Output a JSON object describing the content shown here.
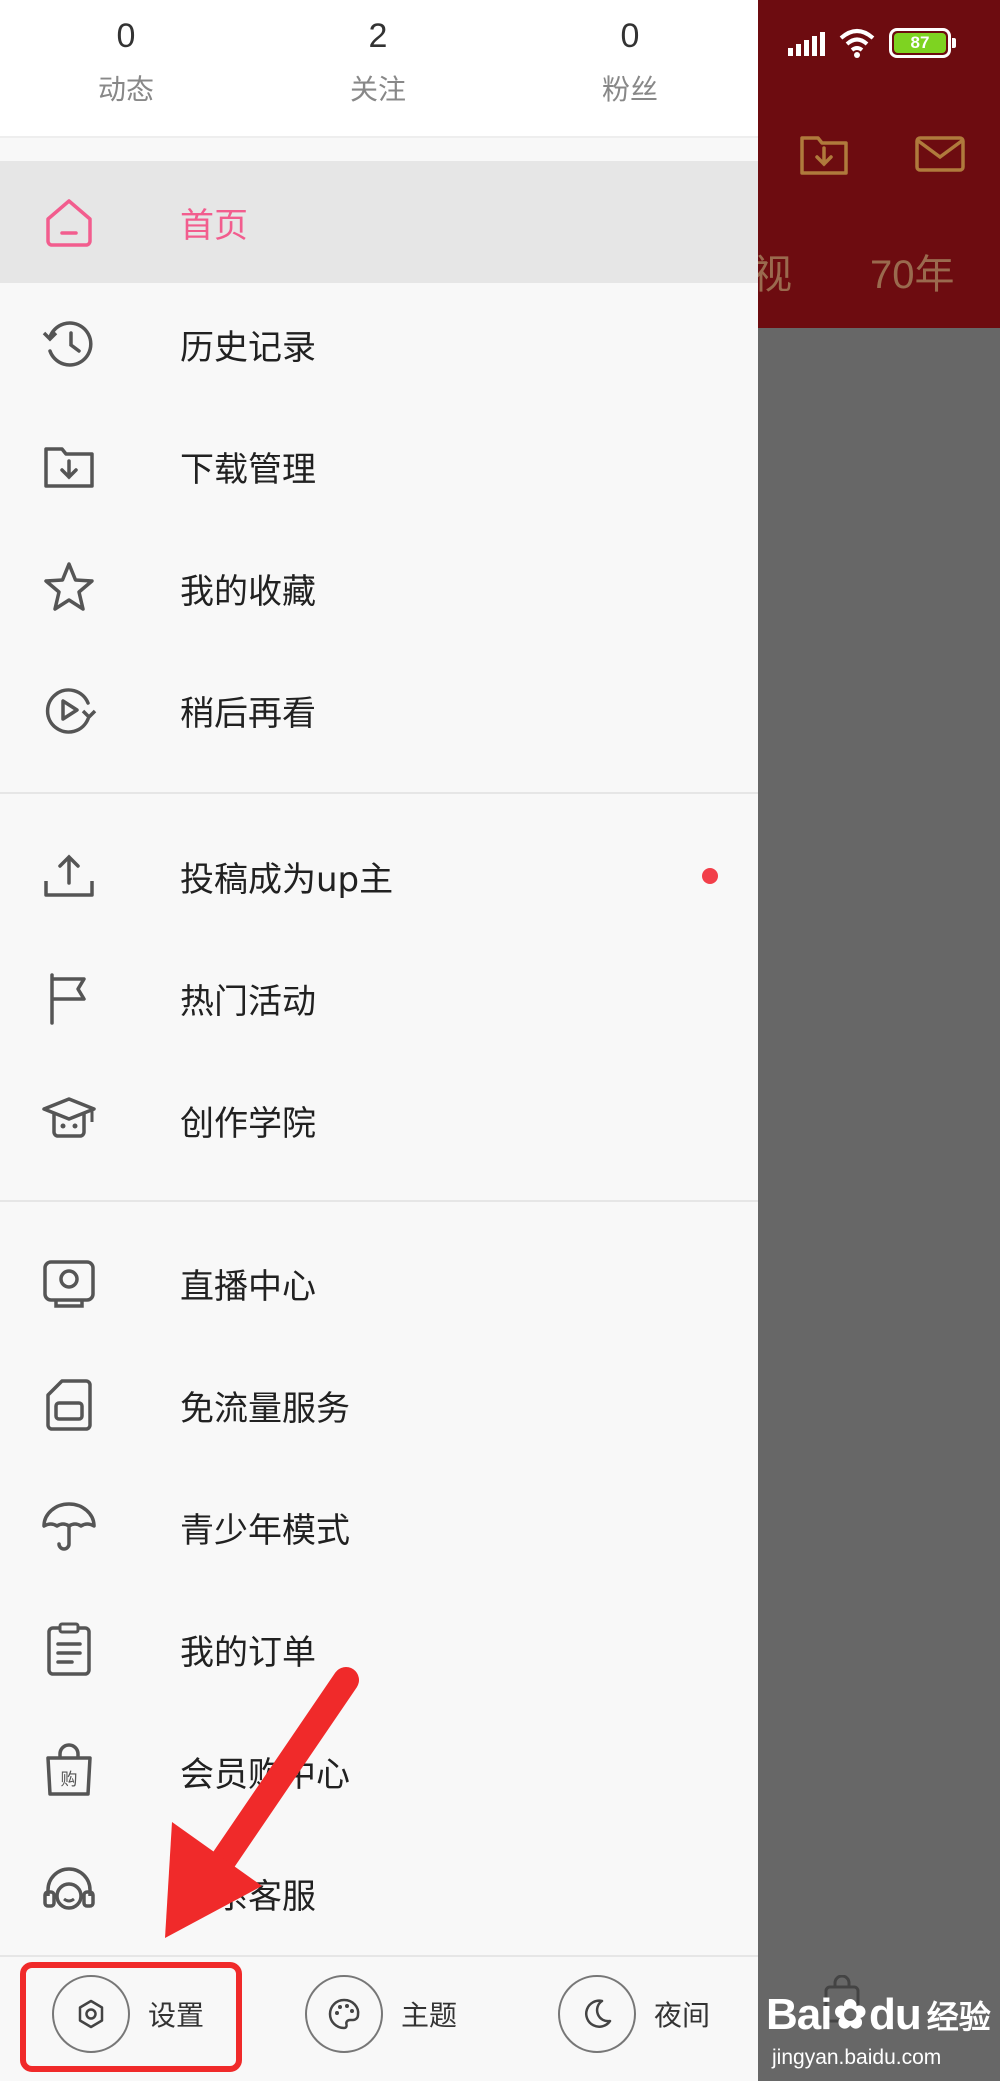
{
  "stats": [
    {
      "count": "0",
      "label": "动态"
    },
    {
      "count": "2",
      "label": "关注"
    },
    {
      "count": "0",
      "label": "粉丝"
    }
  ],
  "menu_group_1": [
    {
      "label": "首页",
      "icon": "home-icon",
      "active": true
    },
    {
      "label": "历史记录",
      "icon": "history-icon"
    },
    {
      "label": "下载管理",
      "icon": "download-folder-icon"
    },
    {
      "label": "我的收藏",
      "icon": "star-icon"
    },
    {
      "label": "稍后再看",
      "icon": "watch-later-icon"
    }
  ],
  "menu_group_2": [
    {
      "label": "投稿成为up主",
      "icon": "upload-icon",
      "badge": "red-dot"
    },
    {
      "label": "热门活动",
      "icon": "flag-icon"
    },
    {
      "label": "创作学院",
      "icon": "graduation-cap-icon"
    }
  ],
  "menu_group_3": [
    {
      "label": "直播中心",
      "icon": "live-tv-icon"
    },
    {
      "label": "免流量服务",
      "icon": "sim-card-icon"
    },
    {
      "label": "青少年模式",
      "icon": "umbrella-icon"
    },
    {
      "label": "我的订单",
      "icon": "clipboard-icon"
    },
    {
      "label": "会员购中心",
      "icon": "shopping-bag-icon"
    },
    {
      "label": "联系客服",
      "icon": "headset-icon"
    }
  ],
  "bottom_bar": {
    "settings": "设置",
    "theme": "主题",
    "night": "夜间"
  },
  "background_app": {
    "tab_partial": "视",
    "tab_70": "70年",
    "battery_level": "87",
    "accent_color": "#6d0c10"
  },
  "watermark": {
    "brand": "Bai",
    "brand_suffix": "du",
    "sub": "经验",
    "url": "jingyan.baidu.com"
  },
  "colors": {
    "active": "#f25d8e",
    "highlight": "#f02a2a",
    "badge": "#f23f4a"
  }
}
